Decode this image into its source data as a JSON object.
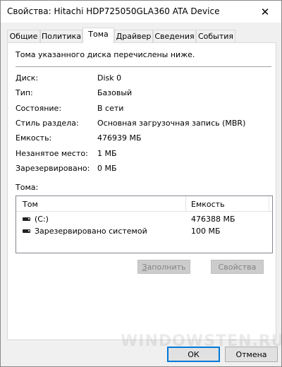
{
  "window": {
    "title": "Свойства: Hitachi HDP725050GLA360 ATA Device",
    "close_glyph": "✕"
  },
  "tabs": [
    {
      "label": "Общие",
      "active": false
    },
    {
      "label": "Политика",
      "active": false
    },
    {
      "label": "Тома",
      "active": true
    },
    {
      "label": "Драйвер",
      "active": false
    },
    {
      "label": "Сведения",
      "active": false
    },
    {
      "label": "События",
      "active": false
    }
  ],
  "panel": {
    "intro": "Тома указанного диска перечислены ниже.",
    "properties": [
      {
        "label": "Диск:",
        "value": "Disk 0"
      },
      {
        "label": "Тип:",
        "value": "Базовый"
      },
      {
        "label": "Состояние:",
        "value": "В сети"
      },
      {
        "label": "Стиль раздела:",
        "value": "Основная загрузочная запись (MBR)"
      },
      {
        "label": "Емкость:",
        "value": "476939 МБ"
      },
      {
        "label": "Незанятое место:",
        "value": "1 МБ"
      },
      {
        "label": "Зарезервировано:",
        "value": "0 МБ"
      }
    ],
    "volumes_label": "Тома:",
    "volumes": {
      "columns": [
        "Том",
        "Емкость"
      ],
      "rows": [
        {
          "name": "(C:)",
          "capacity": "476388 МБ",
          "icon": "drive-icon"
        },
        {
          "name": "Зарезервировано системой",
          "capacity": "100 МБ",
          "icon": "drive-icon"
        }
      ]
    },
    "fill_button": {
      "underlined": "З",
      "rest": "аполнить",
      "enabled": false
    },
    "properties_button": {
      "label": "Свойства",
      "enabled": false
    }
  },
  "footer": {
    "ok_label": "ОК",
    "cancel_label": "Отмена"
  },
  "watermark": "WINDOWSTEN.RU"
}
